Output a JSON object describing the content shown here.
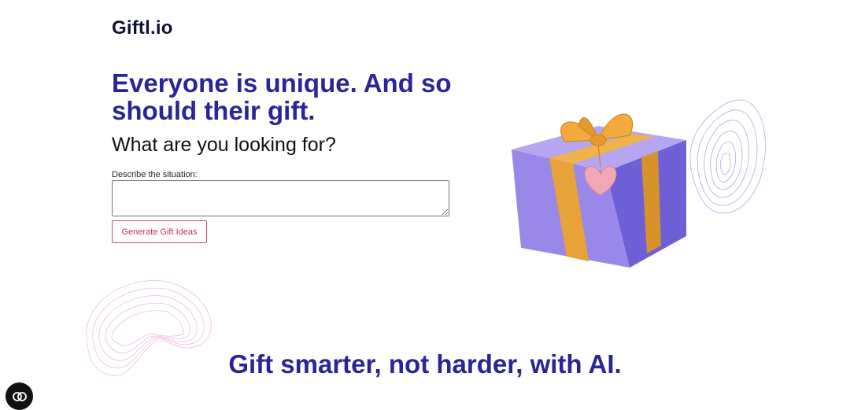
{
  "brand": {
    "logo": "Giftl.io"
  },
  "hero": {
    "title": "Everyone is unique. And so should their gift.",
    "subtitle": "What are you looking for?"
  },
  "form": {
    "label": "Describe the situation:",
    "value": "",
    "button_label": "Generate Gift Ideas"
  },
  "tagline": "Gift smarter, not harder, with AI.",
  "icons": {
    "gift": "gift-box-illustration",
    "swirl": "contour-swirl-decoration",
    "chat": "chat-widget-icon"
  },
  "colors": {
    "accent": "#2a2496",
    "button_border": "#d24a6a",
    "box_purple": "#8f7fe0",
    "ribbon_gold": "#e8a23a",
    "tag_pink": "#f2a6b6"
  }
}
